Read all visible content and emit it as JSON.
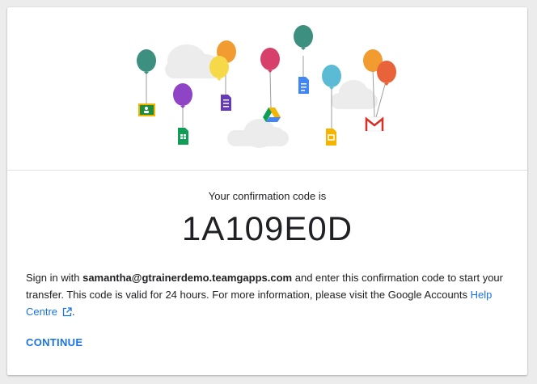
{
  "confirmation": {
    "label": "Your confirmation code is",
    "code": "1A109E0D"
  },
  "message": {
    "prefix": "Sign in with ",
    "email": "samantha@gtrainerdemo.teamgapps.com",
    "middle": " and enter this confirmation code to start your transfer. This code is valid for 24 hours. For more information, please visit the Google Accounts ",
    "link_text": "Help Centre",
    "suffix": "."
  },
  "actions": {
    "continue_label": "CONTINUE"
  },
  "icons": {
    "external_link": "open-in-new-icon",
    "balloons": [
      "google-classroom-icon",
      "google-sheets-icon",
      "google-forms-icon",
      "google-drive-icon",
      "google-docs-icon",
      "google-slides-icon",
      "gmail-icon"
    ]
  },
  "colors": {
    "accent": "#1a73e8",
    "balloon_teal": "#3d8f7f",
    "balloon_purple": "#8e44c4",
    "balloon_orange": "#f29b30",
    "balloon_yellow": "#f5d949",
    "balloon_pink": "#d6406a",
    "balloon_cyan": "#5bbbd4",
    "balloon_red": "#e8623a"
  }
}
